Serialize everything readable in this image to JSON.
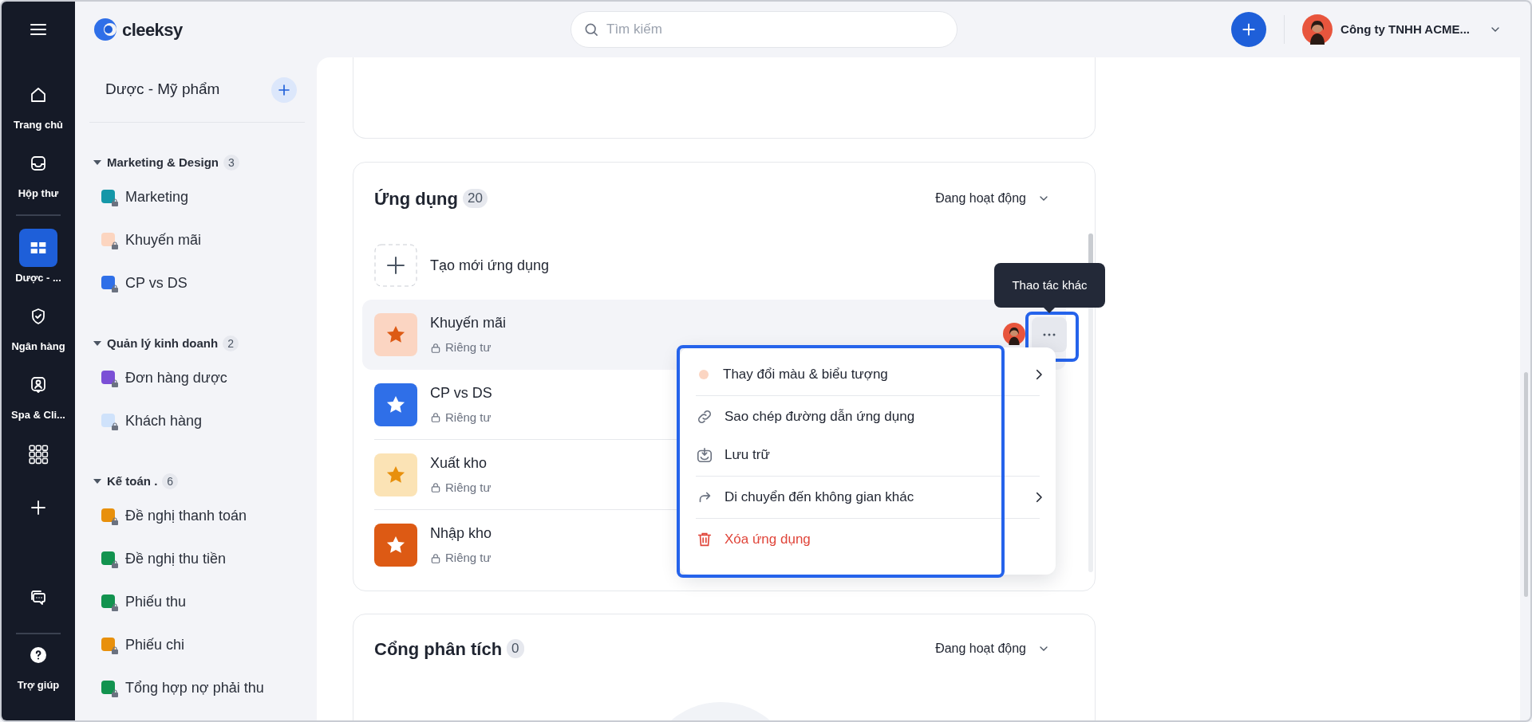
{
  "topbar": {
    "logo": "cleeksy",
    "search": {
      "placeholder": "Tìm kiếm"
    },
    "account": "Công ty TNHH ACME..."
  },
  "rail": {
    "top": [
      {
        "kind": "home",
        "label": "Trang chủ",
        "selected": false
      },
      {
        "kind": "inbox",
        "label": "Hộp thư",
        "selected": false
      },
      {
        "kind": "space",
        "label": "Dược - ...",
        "selected": true
      },
      {
        "kind": "shield",
        "label": "Ngân hàng",
        "selected": false
      },
      {
        "kind": "person",
        "label": "Spa & Cli...",
        "selected": false
      },
      {
        "kind": "grid",
        "selected": false
      },
      {
        "kind": "plus",
        "selected": false
      }
    ],
    "bottom": [
      {
        "kind": "chat",
        "selected": false
      },
      {
        "kind": "help",
        "label": "Trợ giúp",
        "selected": false
      }
    ]
  },
  "sidebar": {
    "title": "Dược - Mỹ phẩm",
    "groups": [
      {
        "name": "Marketing & Design",
        "count": "3",
        "expanded": true,
        "items": [
          {
            "label": "Marketing",
            "color": "#1597a8"
          },
          {
            "label": "Khuyến mãi",
            "color": "#fcd5c0"
          },
          {
            "label": "CP vs DS",
            "color": "#2f6fe8"
          }
        ]
      },
      {
        "name": "Quản lý kinh doanh",
        "count": "2",
        "expanded": true,
        "items": [
          {
            "label": "Đơn hàng dược",
            "color": "#7b4fd6"
          },
          {
            "label": "Khách hàng",
            "color": "#cfe2fb"
          }
        ]
      },
      {
        "name": "Kế toán .",
        "count": "6",
        "expanded": true,
        "items": [
          {
            "label": "Đề nghị thanh toán",
            "color": "#e8900c"
          },
          {
            "label": "Đề nghị thu tiền",
            "color": "#12934f"
          },
          {
            "label": "Phiếu thu",
            "color": "#12934f"
          },
          {
            "label": "Phiếu chi",
            "color": "#e8900c"
          },
          {
            "label": "Tổng hợp nợ phải thu",
            "color": "#12934f"
          }
        ]
      }
    ]
  },
  "apps_card": {
    "title": "Ứng dụng",
    "count": "20",
    "filter": "Đang hoạt động",
    "create_label": "Tạo mới ứng dụng",
    "apps": [
      {
        "name": "Khuyến mãi",
        "privacy": "Riêng tư",
        "color": "#fbd5c2",
        "icon": {
          "color": "#dd5a14"
        },
        "selected": true
      },
      {
        "name": "CP vs DS",
        "privacy": "Riêng tư",
        "color": "#2f6fe8",
        "icon": {
          "color": "#ffffff"
        },
        "selected": false
      },
      {
        "name": "Xuất kho",
        "privacy": "Riêng tư",
        "color": "#fbe3b5",
        "icon": {
          "color": "#e8900c"
        },
        "selected": false
      },
      {
        "name": "Nhập kho",
        "privacy": "Riêng tư",
        "color": "#dd5a14",
        "icon": {
          "color": "#ffffff"
        },
        "selected": false
      }
    ],
    "tooltip": "Thao tác khác",
    "menu": [
      {
        "kind": "color",
        "label": "Thay đổi màu & biểu tượng",
        "color": "#fbd5c2",
        "submenu": true
      },
      {
        "kind": "link",
        "label": "Sao chép đường dẫn ứng dụng",
        "submenu": false
      },
      {
        "kind": "archive",
        "label": "Lưu trữ",
        "submenu": false
      },
      {
        "kind": "move",
        "label": "Di chuyển đến không gian khác",
        "submenu": true
      },
      {
        "kind": "delete",
        "label": "Xóa ứng dụng",
        "submenu": false
      }
    ]
  },
  "analytics_card": {
    "title": "Cổng phân tích",
    "count": "0",
    "filter": "Đang hoạt động"
  }
}
